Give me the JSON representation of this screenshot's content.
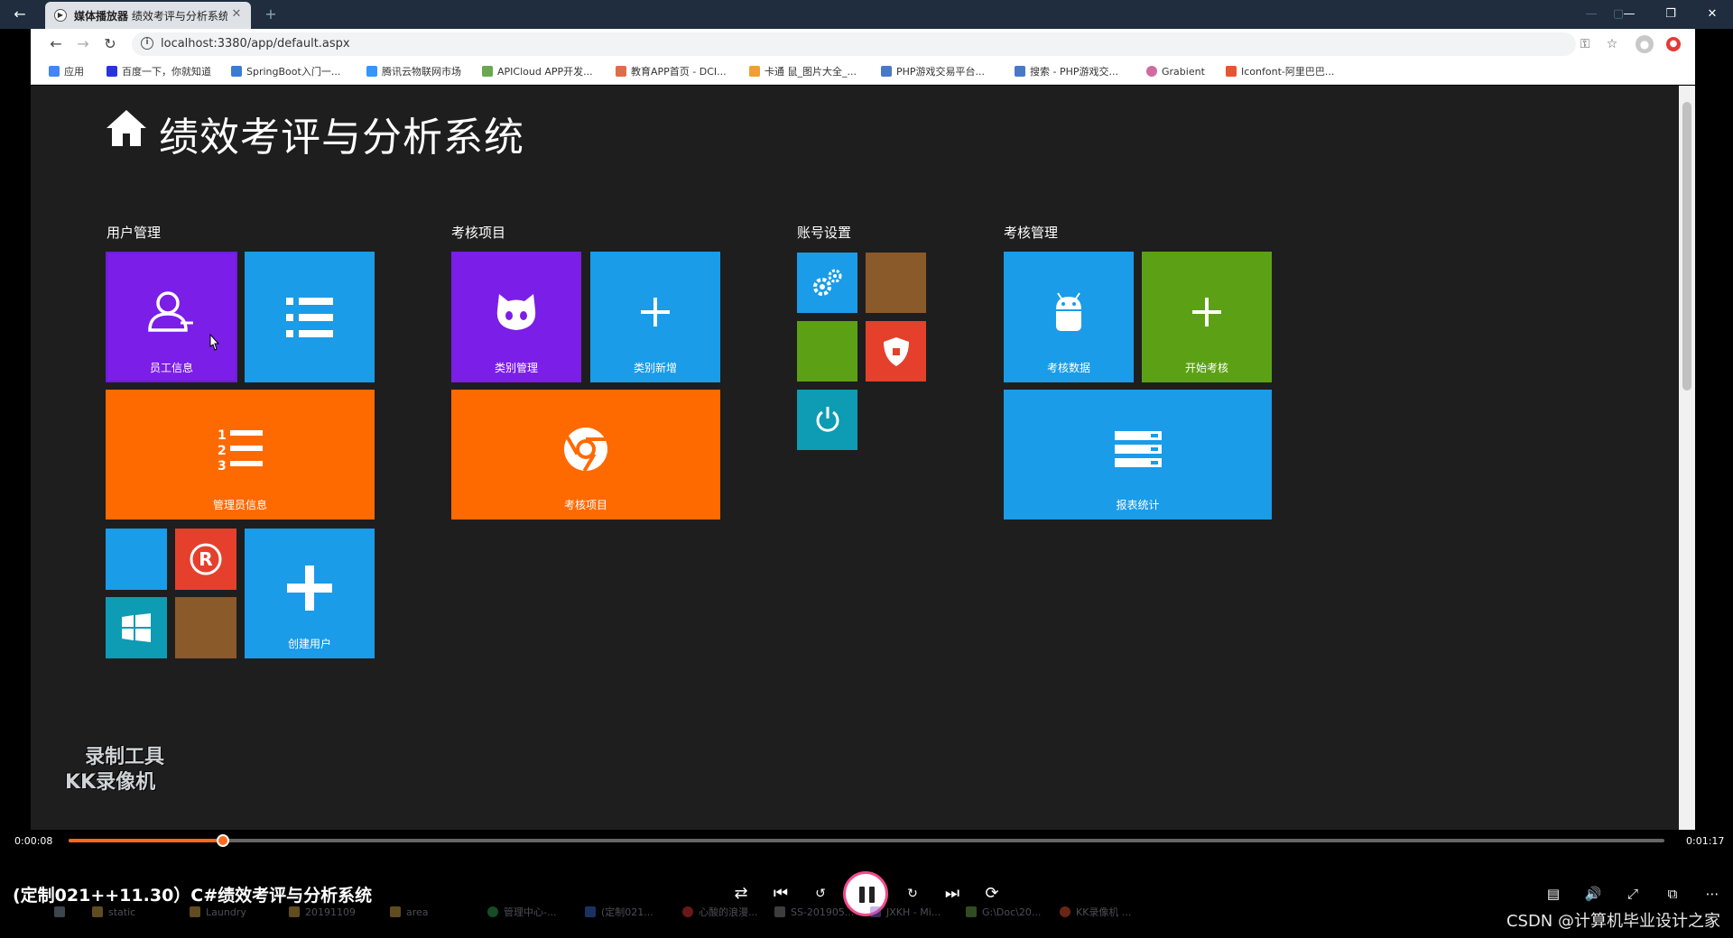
{
  "player": {
    "app_label": "媒体播放器",
    "tab_title": "绩效考评与分析系统",
    "video_title": "(定制021++11.30）C#绩效考评与分析系统",
    "time_current": "0:00:08",
    "time_total": "0:01:17",
    "progress_fraction": 0.097,
    "accent_color": "#ff6a1a"
  },
  "browser": {
    "url": "localhost:3380/app/default.aspx",
    "bookmarks": [
      {
        "label": "应用",
        "icon": "apps-grid-icon",
        "color": "#4285f4"
      },
      {
        "label": "百度一下，你就知道",
        "icon": "baidu-paw-icon",
        "color": "#2932e1"
      },
      {
        "label": "SpringBoot入门一...",
        "icon": "springboot-icon",
        "color": "#3a7bd5"
      },
      {
        "label": "腾讯云物联网市场",
        "icon": "cloud-icon",
        "color": "#3296fa"
      },
      {
        "label": "APICloud APP开发...",
        "icon": "apicloud-icon",
        "color": "#6aa84f"
      },
      {
        "label": "教育APP首页 - DCI...",
        "icon": "play-outline-icon",
        "color": "#e06c4a"
      },
      {
        "label": "卡通 鼠_图片大全_...",
        "icon": "lambda-icon",
        "color": "#f0a030"
      },
      {
        "label": "PHP游戏交易平台...",
        "icon": "php-icon",
        "color": "#4a78c8"
      },
      {
        "label": "搜索 - PHP游戏交...",
        "icon": "php-search-icon",
        "color": "#4a78c8"
      },
      {
        "label": "Grabient",
        "icon": "gradient-circle-icon",
        "color": "#d06aa0"
      },
      {
        "label": "Iconfont-阿里巴巴...",
        "icon": "iconfont-icon",
        "color": "#e8542f"
      }
    ]
  },
  "page": {
    "title": "绩效考评与分析系统",
    "groups": [
      {
        "label": "用户管理"
      },
      {
        "label": "考核项目"
      },
      {
        "label": "账号设置"
      },
      {
        "label": "考核管理"
      }
    ],
    "tiles": {
      "staff_info": "员工信息",
      "admin_info": "管理员信息",
      "create_user": "创建用户",
      "category_manage": "类别管理",
      "category_add": "类别新增",
      "assessment_project": "考核项目",
      "assessment_data": "考核数据",
      "start_assessment": "开始考核",
      "report_stats": "报表统计"
    }
  },
  "watermark": {
    "line1": "录制工具",
    "line2": "KK录像机"
  },
  "taskbar": [
    {
      "label": "static",
      "color": "#d4a94a"
    },
    {
      "label": "Laundry",
      "color": "#d4a94a"
    },
    {
      "label": "20191109",
      "color": "#d4a94a"
    },
    {
      "label": "area",
      "color": "#d4a94a"
    },
    {
      "label": "管理中心-...",
      "color": "#34a853"
    },
    {
      "label": "(定制021...",
      "color": "#3a6fd8"
    },
    {
      "label": "心酸的浪漫...",
      "color": "#e53935"
    },
    {
      "label": "SS-201905...",
      "color": "#888888"
    },
    {
      "label": "JXKH - Mi...",
      "color": "#8a5cd0"
    },
    {
      "label": "G:\\Doc\\20...",
      "color": "#6aa84f"
    },
    {
      "label": "KK录像机 ...",
      "color": "#e8542f"
    }
  ],
  "credit": "CSDN @计算机毕业设计之家"
}
